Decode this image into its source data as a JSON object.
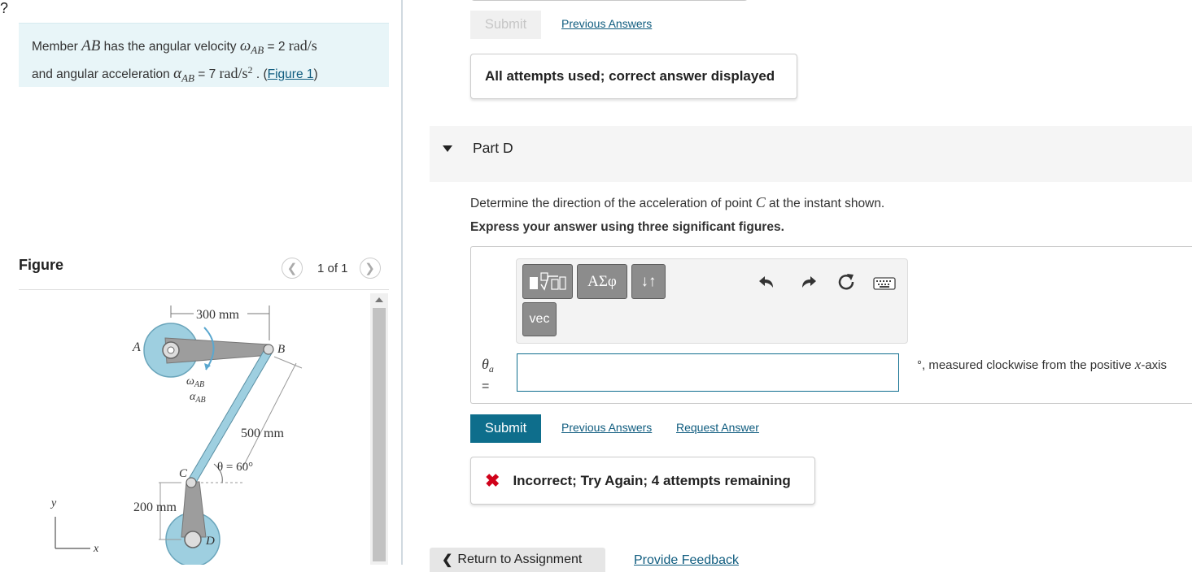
{
  "problem": {
    "line1_prefix": "Member ",
    "member": "AB",
    "line1_mid": " has the angular velocity ",
    "omega_sym": "ω",
    "omega_sub": "AB",
    "omega_eq": " = 2 ",
    "omega_unit": "rad/s",
    "line2_prefix": "and angular acceleration ",
    "alpha_sym": "α",
    "alpha_sub": "AB",
    "alpha_eq": " = 7 ",
    "alpha_unit": "rad/s",
    "alpha_exp": "2",
    "line2_suffix": " . (",
    "figure_link": "Figure 1",
    "close_paren": ")"
  },
  "figure": {
    "heading": "Figure",
    "counter": "1 of 1",
    "prev_icon": "chevron-left-icon",
    "next_icon": "chevron-right-icon",
    "labels": {
      "dim_ab": "300 mm",
      "point_a": "A",
      "point_b": "B",
      "point_c": "C",
      "point_d": "D",
      "omega": "ω",
      "omega_sub": "AB",
      "alpha": "α",
      "alpha_sub": "AB",
      "dim_bc": "500 mm",
      "theta": "θ = 60°",
      "dim_cd": "200 mm",
      "axis_y": "y",
      "axis_x": "x"
    }
  },
  "top": {
    "submit_label": "Submit",
    "previous_answers": "Previous Answers",
    "feedback": "All attempts used; correct answer displayed"
  },
  "part_d": {
    "title": "Part D",
    "question_prefix": "Determine the direction of the acceleration of point ",
    "question_point": "C",
    "question_suffix": " at the instant shown.",
    "instruction": "Express your answer using three significant figures.",
    "toolbar": {
      "greek_label": "ΑΣφ",
      "arrows_label": "↓↑",
      "vec_label": "vec",
      "help_label": "?",
      "icons": [
        "templates-icon",
        "undo-icon",
        "redo-icon",
        "reset-icon",
        "keyboard-icon"
      ]
    },
    "variable": "θ",
    "variable_sub": "a",
    "equals": "=",
    "answer_value": "",
    "units_prefix": "°, measured clockwise from the positive ",
    "units_var": "x",
    "units_suffix": "-axis",
    "submit_label": "Submit",
    "previous_answers": "Previous Answers",
    "request_answer": "Request Answer",
    "feedback": "Incorrect; Try Again; 4 attempts remaining",
    "feedback_icon": "x-icon"
  },
  "footer": {
    "return_label": "Return to Assignment",
    "provide_feedback": "Provide Feedback"
  },
  "colors": {
    "accent": "#0e6e8c",
    "link": "#0f5c7f",
    "problem_bg": "#e8f5f8",
    "error": "#d0021b",
    "pulley": "#9ecfe0"
  }
}
